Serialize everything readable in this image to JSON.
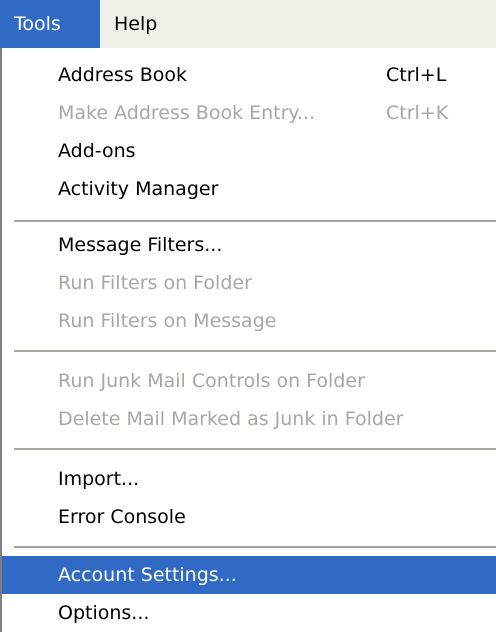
{
  "menubar": {
    "tools": "Tools",
    "help": "Help"
  },
  "menu": {
    "items": [
      {
        "label": "Address Book",
        "shortcut": "Ctrl+L",
        "enabled": true
      },
      {
        "label": "Make Address Book Entry...",
        "shortcut": "Ctrl+K",
        "enabled": false
      },
      {
        "label": "Add-ons",
        "enabled": true
      },
      {
        "label": "Activity Manager",
        "enabled": true
      },
      {
        "label": "Message Filters...",
        "enabled": true
      },
      {
        "label": "Run Filters on Folder",
        "enabled": false
      },
      {
        "label": "Run Filters on Message",
        "enabled": false
      },
      {
        "label": "Run Junk Mail Controls on Folder",
        "enabled": false
      },
      {
        "label": "Delete Mail Marked as Junk in Folder",
        "enabled": false
      },
      {
        "label": "Import...",
        "enabled": true
      },
      {
        "label": "Error Console",
        "enabled": true
      },
      {
        "label": "Account Settings...",
        "enabled": true,
        "highlighted": true
      },
      {
        "label": "Options...",
        "enabled": true
      }
    ]
  },
  "colors": {
    "highlight": "#316ac5",
    "disabled_text": "#a9a79e",
    "menubar_bg": "#f0efe8"
  }
}
